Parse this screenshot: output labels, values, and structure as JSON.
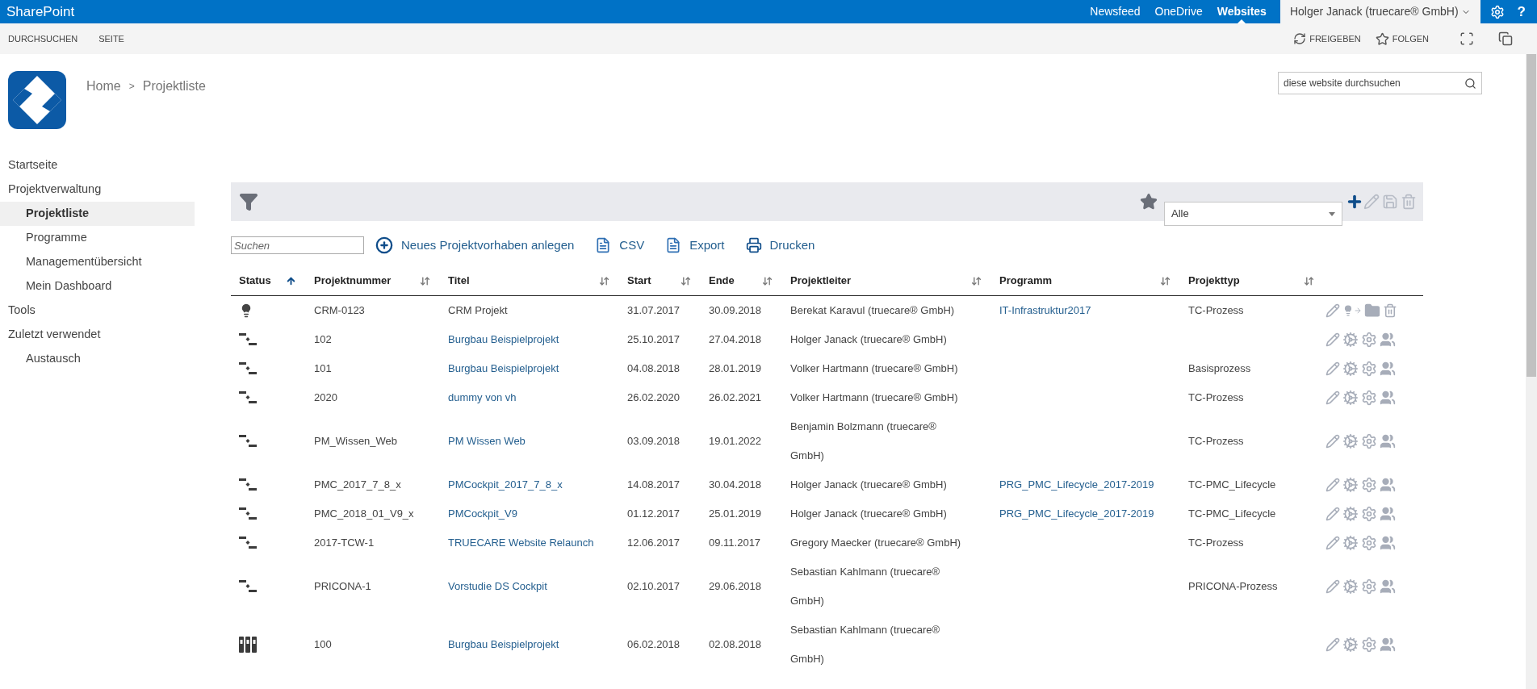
{
  "suite_bar": {
    "brand": "SharePoint",
    "links": [
      {
        "label": "Newsfeed",
        "selected": false
      },
      {
        "label": "OneDrive",
        "selected": false
      },
      {
        "label": "Websites",
        "selected": true
      }
    ],
    "user": "Holger Janack (truecare® GmbH)",
    "help": "?"
  },
  "ribbon": {
    "tabs": [
      "DURCHSUCHEN",
      "SEITE"
    ],
    "actions": [
      {
        "kind": "share",
        "label": "FREIGEBEN"
      },
      {
        "kind": "follow",
        "label": "FOLGEN"
      }
    ]
  },
  "breadcrumb": {
    "items": [
      "Home",
      "Projektliste"
    ],
    "separator": ">"
  },
  "site_search": {
    "placeholder": "diese website durchsuchen"
  },
  "nav": [
    {
      "label": "Startseite",
      "selected": false
    },
    {
      "label": "Projektverwaltung",
      "selected": false,
      "children": [
        {
          "label": "Projektliste",
          "selected": true
        },
        {
          "label": "Programme",
          "selected": false
        },
        {
          "label": "Managementübersicht",
          "selected": false
        },
        {
          "label": "Mein Dashboard",
          "selected": false
        }
      ]
    },
    {
      "label": "Tools",
      "selected": false
    },
    {
      "label": "Zuletzt verwendet",
      "selected": false,
      "children": [
        {
          "label": "Austausch",
          "selected": false
        }
      ]
    }
  ],
  "filter_bar": {
    "view_select": "Alle"
  },
  "toolbar": {
    "search_placeholder": "Suchen",
    "actions": [
      {
        "kind": "add",
        "label": "Neues Projektvorhaben anlegen"
      },
      {
        "kind": "csv",
        "label": "CSV"
      },
      {
        "kind": "pdf",
        "label": "Export"
      },
      {
        "kind": "print",
        "label": "Drucken"
      }
    ]
  },
  "table": {
    "columns": [
      {
        "label": "Status",
        "kind": "sorted"
      },
      {
        "label": "Projektnummer",
        "kind": "sortable"
      },
      {
        "label": "Titel",
        "kind": "sortable"
      },
      {
        "label": "Start",
        "kind": "sortable"
      },
      {
        "label": "Ende",
        "kind": "sortable"
      },
      {
        "label": "Projektleiter",
        "kind": "sortable"
      },
      {
        "label": "Programm",
        "kind": "sortable"
      },
      {
        "label": "Projekttyp",
        "kind": "sortable"
      }
    ],
    "rows": [
      {
        "kind": "idea",
        "number": "CRM-0123",
        "title": "CRM Projekt",
        "title_link": false,
        "start": "31.07.2017",
        "end": "30.09.2018",
        "lead": "Berekat Karavul (truecare® GmbH)",
        "program": "IT-Infrastruktur2017",
        "type": "TC-Prozess"
      },
      {
        "kind": "plan",
        "number": "102",
        "title": "Burgbau Beispielprojekt",
        "title_link": true,
        "start": "25.10.2017",
        "end": "27.04.2018",
        "lead": "Holger Janack (truecare® GmbH)"
      },
      {
        "kind": "plan",
        "number": "101",
        "title": "Burgbau Beispielprojekt",
        "title_link": true,
        "start": "04.08.2018",
        "end": "28.01.2019",
        "lead": "Volker Hartmann (truecare® GmbH)",
        "type": "Basisprozess"
      },
      {
        "kind": "plan",
        "number": "2020",
        "title": "dummy von vh",
        "title_link": true,
        "start": "26.02.2020",
        "end": "26.02.2021",
        "lead": "Volker Hartmann (truecare® GmbH)",
        "type": "TC-Prozess"
      },
      {
        "kind": "plan",
        "number": "PM_Wissen_Web",
        "title": "PM Wissen Web",
        "title_link": true,
        "start": "03.09.2018",
        "end": "19.01.2022",
        "lead": "Benjamin Bolzmann (truecare® GmbH)",
        "type": "TC-Prozess"
      },
      {
        "kind": "plan",
        "number": "PMC_2017_7_8_x",
        "title": "PMCockpit_2017_7_8_x",
        "title_link": true,
        "start": "14.08.2017",
        "end": "30.04.2018",
        "lead": "Holger Janack (truecare® GmbH)",
        "program": "PRG_PMC_Lifecycle_2017-2019",
        "type": "TC-PMC_Lifecycle"
      },
      {
        "kind": "plan",
        "number": "PMC_2018_01_V9_x",
        "title": "PMCockpit_V9",
        "title_link": true,
        "start": "01.12.2017",
        "end": "25.01.2019",
        "lead": "Holger Janack (truecare® GmbH)",
        "program": "PRG_PMC_Lifecycle_2017-2019",
        "type": "TC-PMC_Lifecycle"
      },
      {
        "kind": "plan",
        "number": "2017-TCW-1",
        "title": "TRUECARE Website Relaunch",
        "title_link": true,
        "start": "12.06.2017",
        "end": "09.11.2017",
        "lead": "Gregory Maecker (truecare® GmbH)",
        "type": "TC-Prozess"
      },
      {
        "kind": "plan",
        "number": "PRICONA-1",
        "title": "Vorstudie DS Cockpit",
        "title_link": true,
        "start": "02.10.2017",
        "end": "29.06.2018",
        "lead": "Sebastian Kahlmann (truecare® GmbH)",
        "type": "PRICONA-Prozess"
      },
      {
        "kind": "binder",
        "number": "100",
        "title": "Burgbau Beispielprojekt",
        "title_link": true,
        "start": "06.02.2018",
        "end": "02.08.2018",
        "lead": "Sebastian Kahlmann (truecare® GmbH)"
      }
    ]
  }
}
